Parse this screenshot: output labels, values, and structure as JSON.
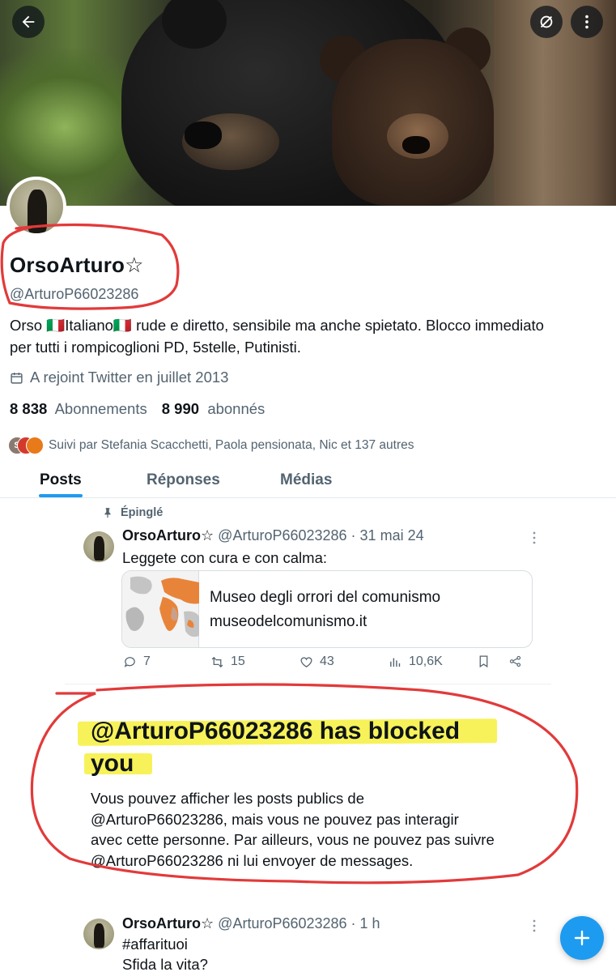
{
  "profile": {
    "name": "OrsoArturo",
    "name_star": "☆",
    "handle": "@ArturoP66023286",
    "bio_line1": "Orso 🇮🇹Italiano🇮🇹 rude e diretto, sensibile ma anche spietato. Blocco immediato",
    "bio_line2": "per tutti i rompicoglioni PD, 5stelle, Putinisti.",
    "joined": "A rejoint Twitter en juillet 2013",
    "following_count": "8 838",
    "following_label": "Abonnements",
    "followers_count": "8 990",
    "followers_label": "abonnés",
    "followed_by": "Suivi par Stefania Scacchetti, Paola pensionata, Nic et 137 autres",
    "mini_avatar_letters": [
      "S",
      "",
      ""
    ]
  },
  "tabs": [
    {
      "label": "Posts"
    },
    {
      "label": "Réponses"
    },
    {
      "label": "Médias"
    }
  ],
  "pinned_tweet": {
    "pinned_label": "Épinglé",
    "author": "OrsoArturo☆",
    "handle_date": "@ArturoP66023286 · 31 mai 24",
    "text": "Leggete con cura e con calma:",
    "card_title": "Museo degli orrori del comunismo",
    "card_domain": "museodelcomunismo.it",
    "replies": "7",
    "retweets": "15",
    "likes": "43",
    "views": "10,6K"
  },
  "blocked": {
    "title_line1": "@ArturoP66023286 has blocked",
    "title_line2": "you",
    "desc_line1": "Vous pouvez afficher les posts publics de",
    "desc_line2": "@ArturoP66023286, mais vous ne pouvez pas interagir",
    "desc_line3": "avec cette personne. Par ailleurs, vous ne pouvez pas suivre",
    "desc_line4": "@ArturoP66023286 ni lui envoyer de messages."
  },
  "second_tweet": {
    "author": "OrsoArturo☆",
    "handle_date": "@ArturoP66023286 · 1 h",
    "line1": "#affarituoi",
    "line2": "Sfida la vita?"
  },
  "colors": {
    "accent": "#1d9bf0",
    "annotation_red": "#e23a3a",
    "highlight_yellow": "#f6f03c"
  },
  "icons": [
    "back-arrow-icon",
    "grok-icon",
    "more-vertical-icon",
    "calendar-icon",
    "pin-icon",
    "reply-icon",
    "retweet-icon",
    "like-icon",
    "views-icon",
    "bookmark-icon",
    "share-icon",
    "compose-plus-icon"
  ]
}
